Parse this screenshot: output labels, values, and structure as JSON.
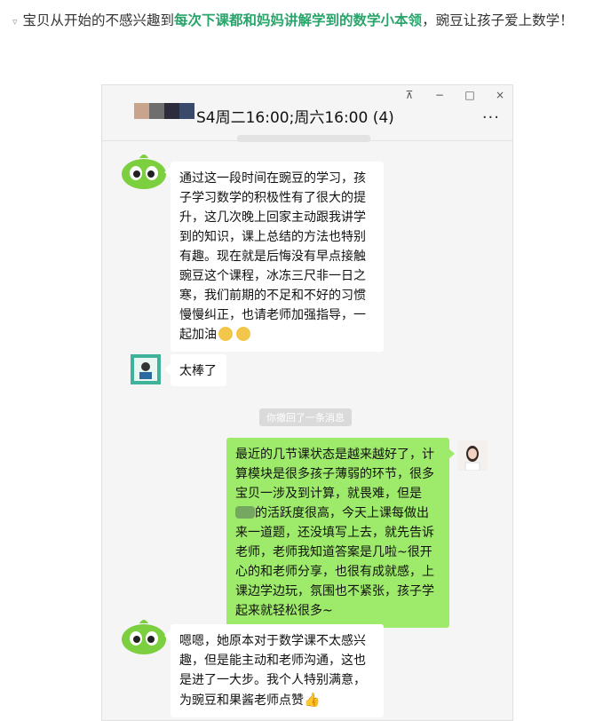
{
  "caption": {
    "bullet": "▿",
    "part1": "宝贝从开始的不感兴趣到",
    "highlight": "每次下课都和妈妈讲解学到的数学小本领",
    "part2": "，豌豆让孩子爱上数学！"
  },
  "window": {
    "title": "S4周二16:00;周六16:00 (4)",
    "controls": {
      "pin": "⊼",
      "minimize": "−",
      "maximize": "□",
      "close": "×"
    },
    "more": "···"
  },
  "messages": {
    "m1": "通过这一段时间在豌豆的学习，孩子学习数学的积极性有了很大的提升，这几次晚上回家主动跟我讲学到的知识，课上总结的方法也特别有趣。现在就是后悔没有早点接触豌豆这个课程，冰冻三尺非一日之寒，我们前期的不足和不好的习惯慢慢纠正，也请老师加强指导，一起加油",
    "m2": "太棒了",
    "system_recall": "你撤回了一条消息",
    "m3_a": "最近的几节课状态是越来越好了，计算模块是很多孩子薄弱的环节，很多宝贝一涉及到计算，就畏难，但是",
    "m3_b": "的活跃度很高，今天上课每做出来一道题，还没填写上去，就先告诉老师，老师我知道答案是几啦~很开心的和老师分享，也很有成就感，上课边学边玩，氛围也不紧张，孩子学起来就轻松很多~",
    "m4": "嗯嗯，她原本对于数学课不太感兴趣，但是能主动和老师沟通，这也是进了一大步。我个人特别满意，为豌豆和果酱老师点赞"
  },
  "colors": {
    "highlight": "#29a56b",
    "my_bubble": "#9eea6a",
    "mascot": "#7ccf3e"
  },
  "icons": {
    "emoji": "muscle-emoji-icon",
    "thumb": "thumbs-up-icon"
  }
}
